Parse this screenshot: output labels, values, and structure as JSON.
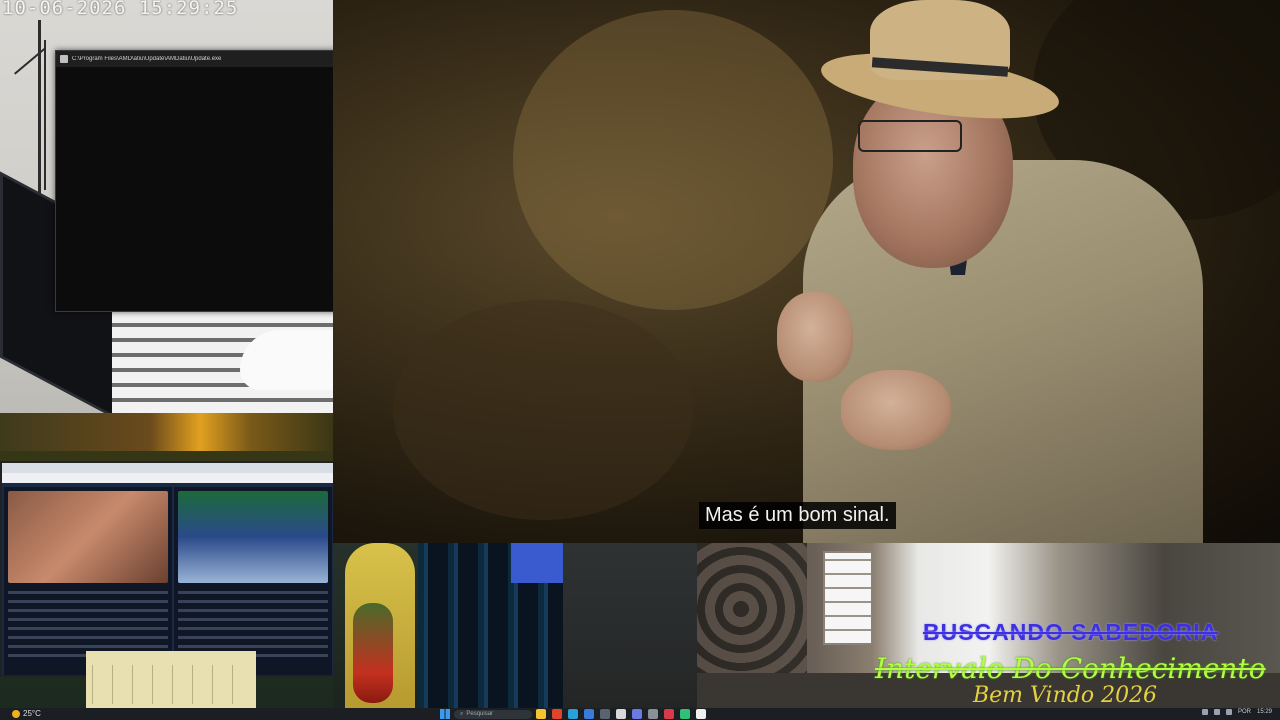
{
  "camera": {
    "timestamp": "10-06-2026 15:29:25"
  },
  "terminal": {
    "title": "C:\\Program Files\\AMD\\atiu\\Update\\AMDatiu\\Update.exe",
    "minimize_glyph": "─",
    "maximize_glyph": "□",
    "close_glyph": "✕"
  },
  "video": {
    "subtitle": "Mas é um bom sinal."
  },
  "overlays": {
    "line1": "BUSCANDO SABEDORIA",
    "line2": "Intervalo Do Conhecimento",
    "line3": "Bem Vindo 2026"
  },
  "taskbar": {
    "weather": "25°C",
    "search_placeholder": "Pesquisar",
    "apps": [
      {
        "name": "file-explorer",
        "color": "#f4c430"
      },
      {
        "name": "chrome",
        "color": "#e0442a"
      },
      {
        "name": "edge",
        "color": "#2aa0d8"
      },
      {
        "name": "store",
        "color": "#3a7ad8"
      },
      {
        "name": "terminal",
        "color": "#5a6470"
      },
      {
        "name": "obs",
        "color": "#d8d8d8"
      },
      {
        "name": "discord",
        "color": "#6a7ae0"
      },
      {
        "name": "settings",
        "color": "#8a9098"
      },
      {
        "name": "media",
        "color": "#d83a4a"
      },
      {
        "name": "green-app",
        "color": "#30c078"
      },
      {
        "name": "white-app",
        "color": "#f0f0f0"
      }
    ],
    "lang": "POR",
    "clock": "15:29"
  }
}
